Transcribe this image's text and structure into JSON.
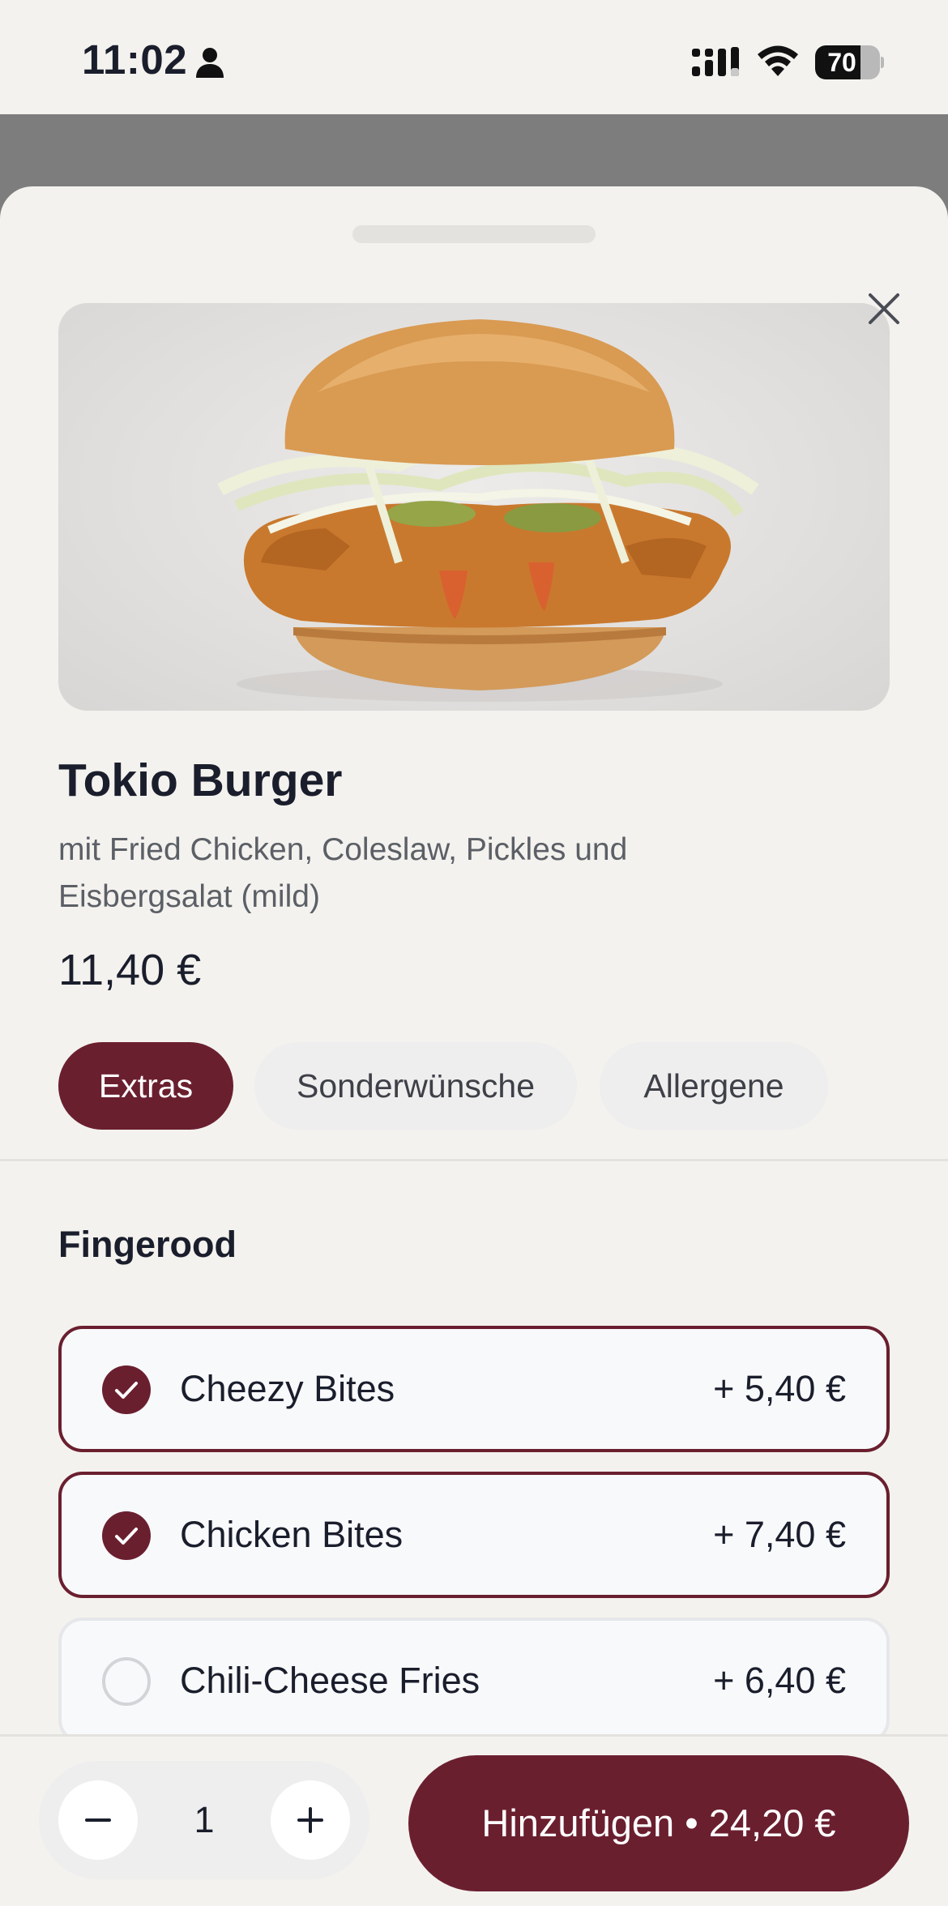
{
  "status_bar": {
    "time": "11:02",
    "battery": "70",
    "battery_level": 0.7,
    "icons": [
      "person-icon",
      "signal-icon",
      "wifi-icon",
      "battery-icon"
    ]
  },
  "product": {
    "name": "Tokio Burger",
    "description": "mit Fried Chicken, Coleslaw, Pickles und Eisbergsalat (mild)",
    "price": "11,40 €"
  },
  "tabs": [
    {
      "label": "Extras",
      "active": true
    },
    {
      "label": "Sonderwünsche",
      "active": false
    },
    {
      "label": "Allergene",
      "active": false
    }
  ],
  "section": {
    "title": "Fingerood",
    "options": [
      {
        "label": "Cheezy Bites",
        "price": "+ 5,40 €",
        "selected": true
      },
      {
        "label": "Chicken Bites",
        "price": "+ 7,40 €",
        "selected": true
      },
      {
        "label": "Chili-Cheese Fries",
        "price": "+ 6,40 €",
        "selected": false
      }
    ]
  },
  "cart": {
    "quantity": "1",
    "add_label": "Hinzufügen • 24,20 €"
  },
  "colors": {
    "accent": "#6a1f2f",
    "background": "#f4f2ee",
    "chip": "#eeeeee"
  }
}
